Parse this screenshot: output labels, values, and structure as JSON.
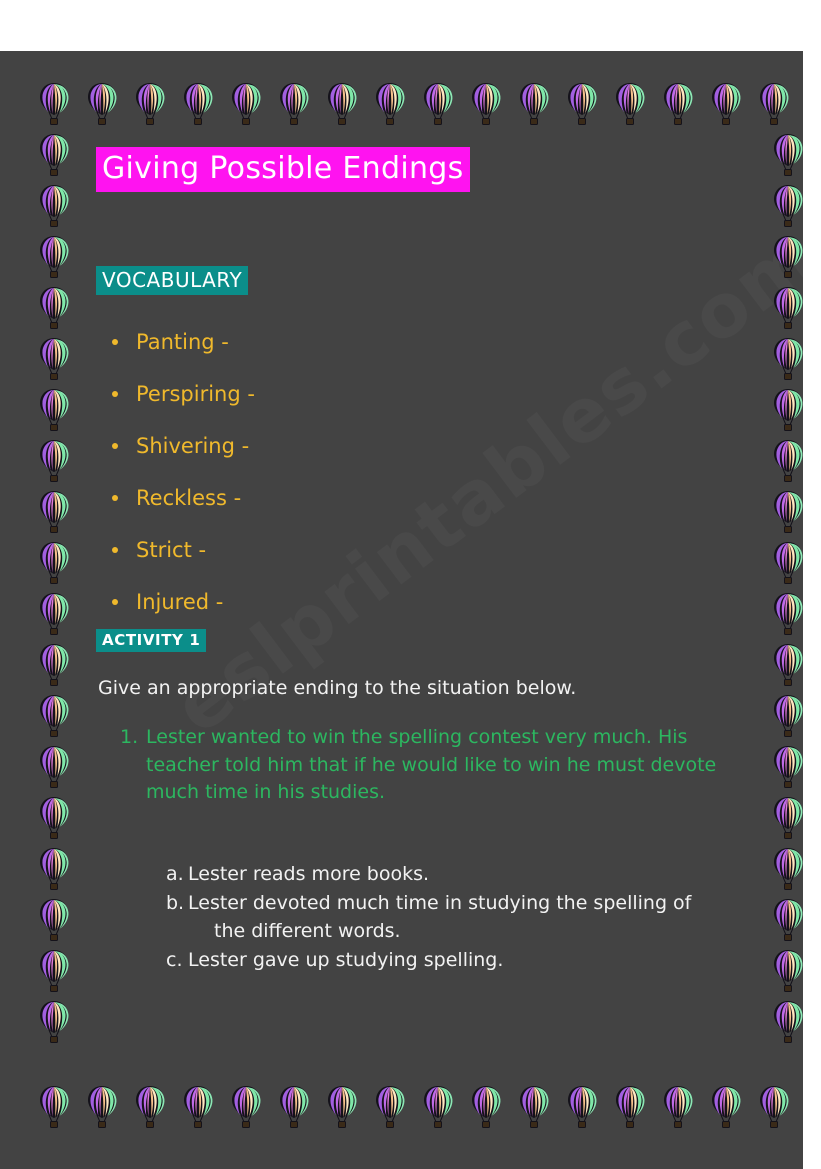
{
  "page": {
    "background_color": "#434343",
    "sheet_color": "#434343",
    "outer_color": "#ffffff",
    "watermark_text": "eslprintables.com"
  },
  "title": {
    "text": "Giving Possible Endings",
    "highlight_color": "#ff13f0",
    "text_color": "#ffffff"
  },
  "vocabulary": {
    "heading": "VOCABULARY",
    "heading_highlight_color": "#0b8e8a",
    "item_color": "#f0b92c",
    "items": [
      "Panting -",
      "Perspiring -",
      "Shivering -",
      "Reckless -",
      "Strict -",
      "Injured -"
    ]
  },
  "activity": {
    "heading": "ACTIVITY 1",
    "heading_highlight_color": "#0b8e8a",
    "instruction": "Give an appropriate ending to the situation below.",
    "situation_color": "#2cb760",
    "situations": [
      {
        "number": "1.",
        "text": "Lester wanted to win the spelling contest very much. His teacher told him that if he would like to win he must devote much time in his studies."
      }
    ],
    "options": [
      {
        "letter": "a.",
        "text": "Lester reads more books.",
        "continuation": ""
      },
      {
        "letter": "b.",
        "text": "Lester devoted much time in studying the spelling of",
        "continuation": "the different words."
      },
      {
        "letter": "c.",
        "text": "Lester gave up studying spelling.",
        "continuation": ""
      }
    ]
  },
  "decoration": {
    "motif": "hot-air-balloon",
    "colors": {
      "purple": "#a25fe0",
      "violet": "#c06ae8",
      "pink": "#e07ad8",
      "peach": "#f5c08a",
      "cream": "#ffe6c0",
      "mint": "#7fe8a8",
      "green": "#8ce8b4",
      "outline": "#14121a",
      "basket": "#3a2a18"
    },
    "top_row_count": 17,
    "bottom_row_count": 17,
    "left_column_count": 19,
    "right_column_count": 19
  }
}
